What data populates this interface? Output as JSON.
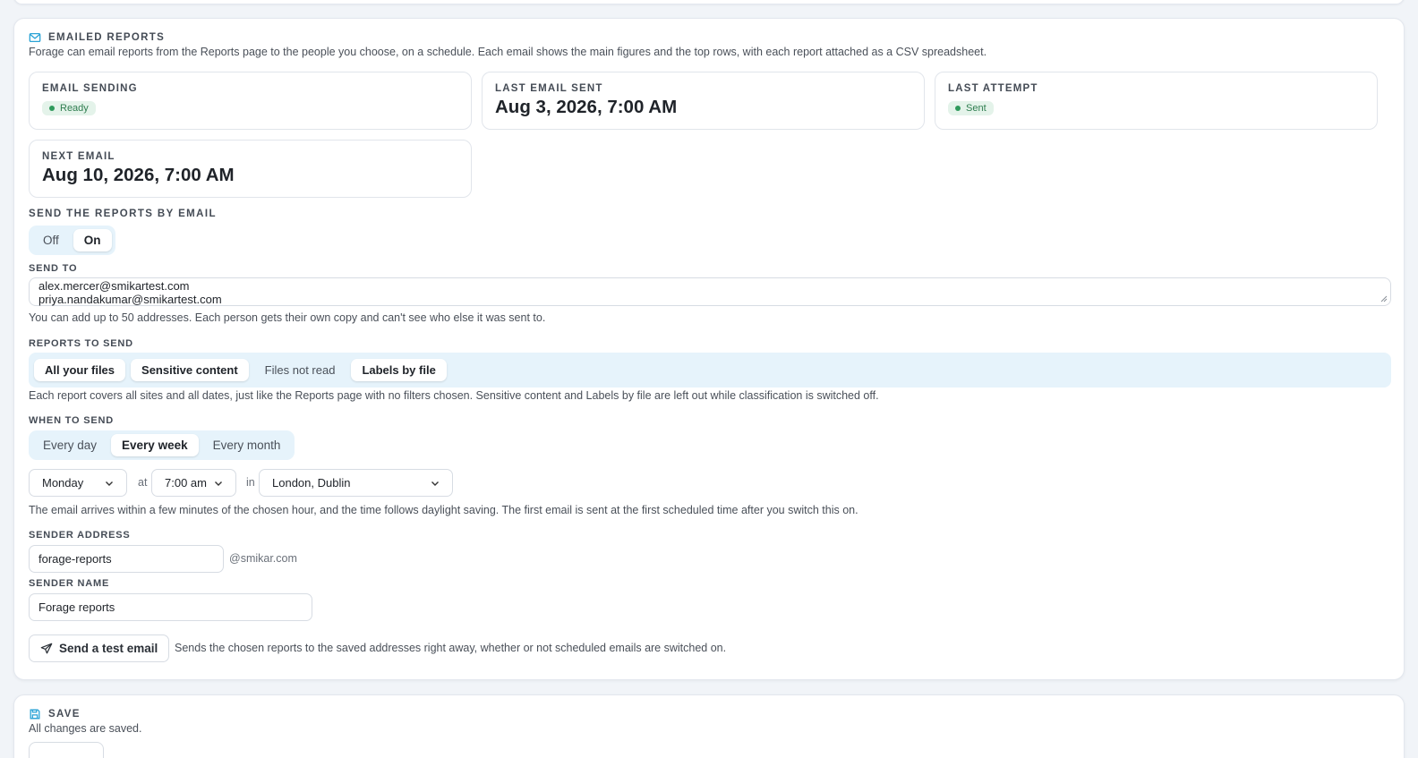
{
  "emailed": {
    "title": "EMAILED REPORTS",
    "description": "Forage can email reports from the Reports page to the people you choose, on a schedule. Each email shows the main figures and the top rows, with each report attached as a CSV spreadsheet.",
    "stats": {
      "email_sending": {
        "label": "EMAIL SENDING",
        "badge": "Ready"
      },
      "last_email_sent": {
        "label": "LAST EMAIL SENT",
        "value": "Aug 3, 2026, 7:00 AM"
      },
      "last_attempt": {
        "label": "LAST ATTEMPT",
        "badge": "Sent"
      },
      "next_email": {
        "label": "NEXT EMAIL",
        "value": "Aug 10, 2026, 7:00 AM"
      }
    },
    "send_toggle": {
      "label": "SEND THE REPORTS BY EMAIL",
      "off": "Off",
      "on": "On",
      "selected": "On"
    },
    "send_to": {
      "label": "SEND TO",
      "line1": "alex.mercer@smikartest.com",
      "line2": "priya.nandakumar@smikartest.com",
      "help": "You can add up to 50 addresses. Each person gets their own copy and can't see who else it was sent to."
    },
    "reports": {
      "label": "REPORTS TO SEND",
      "items": [
        {
          "label": "All your files",
          "selected": true
        },
        {
          "label": "Sensitive content",
          "selected": true
        },
        {
          "label": "Files not read",
          "selected": false
        },
        {
          "label": "Labels by file",
          "selected": true
        }
      ],
      "help": "Each report covers all sites and all dates, just like the Reports page with no filters chosen. Sensitive content and Labels by file are left out while classification is switched off."
    },
    "schedule": {
      "label": "WHEN TO SEND",
      "options": [
        "Every day",
        "Every week",
        "Every month"
      ],
      "selected": "Every week",
      "day": "Monday",
      "at_word": "at",
      "time": "7:00 am",
      "in_word": "in",
      "timezone": "London, Dublin",
      "help": "The email arrives within a few minutes of the chosen hour, and the time follows daylight saving. The first email is sent at the first scheduled time after you switch this on."
    },
    "sender_address": {
      "label": "SENDER ADDRESS",
      "value": "forage-reports",
      "domain": "@smikar.com"
    },
    "sender_name": {
      "label": "SENDER NAME",
      "value": "Forage reports"
    },
    "test": {
      "button": "Send a test email",
      "help": "Sends the chosen reports to the saved addresses right away, whether or not scheduled emails are switched on."
    }
  },
  "save": {
    "title": "SAVE",
    "status": "All changes are saved."
  },
  "colors": {
    "accent": "#2aa3d6",
    "ready_badge_bg": "#e4f3ea",
    "ready_badge_text": "#2e7d4f",
    "segment_bg": "#e6f3fb"
  }
}
